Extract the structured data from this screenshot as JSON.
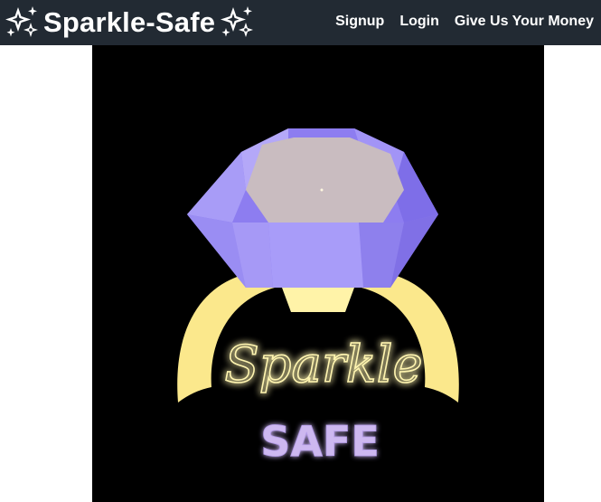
{
  "navbar": {
    "brand_title": "Sparkle-Safe",
    "brand_icon": "sparkle-icon",
    "background_color": "#222a33",
    "links": [
      {
        "label": "Signup"
      },
      {
        "label": "Login"
      },
      {
        "label": "Give Us Your Money"
      }
    ]
  },
  "hero": {
    "background_color": "#000000",
    "logo": {
      "script_text": "Sparkle",
      "block_text": "SAFE",
      "gem_color": "#9b8ff5",
      "gem_table_color": "#c9bcc0",
      "band_color": "#fbe88c",
      "script_color": "#fff5b0",
      "safe_color": "#cdb8f0"
    }
  }
}
